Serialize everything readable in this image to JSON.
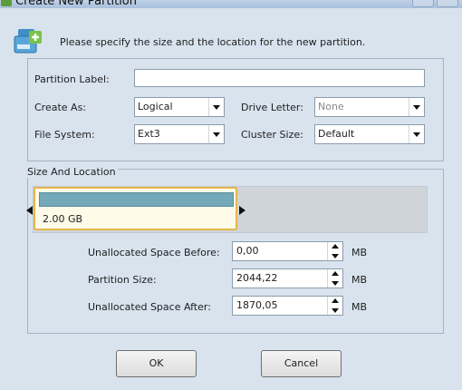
{
  "window": {
    "title": "Create New Partition"
  },
  "instruction": "Please specify the size and the location for the new partition.",
  "form": {
    "partition_label": {
      "label": "Partition Label:",
      "value": ""
    },
    "create_as": {
      "label": "Create As:",
      "value": "Logical"
    },
    "drive_letter": {
      "label": "Drive Letter:",
      "value": "None"
    },
    "file_system": {
      "label": "File System:",
      "value": "Ext3"
    },
    "cluster_size": {
      "label": "Cluster Size:",
      "value": "Default"
    }
  },
  "size_location": {
    "title": "Size And Location",
    "partition_size_display": "2.00 GB",
    "unallocated_before": {
      "label": "Unallocated Space Before:",
      "value": "0,00",
      "unit": "MB"
    },
    "partition_size": {
      "label": "Partition Size:",
      "value": "2044,22",
      "unit": "MB"
    },
    "unallocated_after": {
      "label": "Unallocated Space After:",
      "value": "1870,05",
      "unit": "MB"
    }
  },
  "buttons": {
    "ok": "OK",
    "cancel": "Cancel"
  },
  "icons": {
    "header": "partition-wizard-icon",
    "titlebar": "app-icon"
  },
  "colors": {
    "partition_bar": "#73a9b9",
    "partition_border": "#e5b64c",
    "background": "#d8e3ee"
  }
}
